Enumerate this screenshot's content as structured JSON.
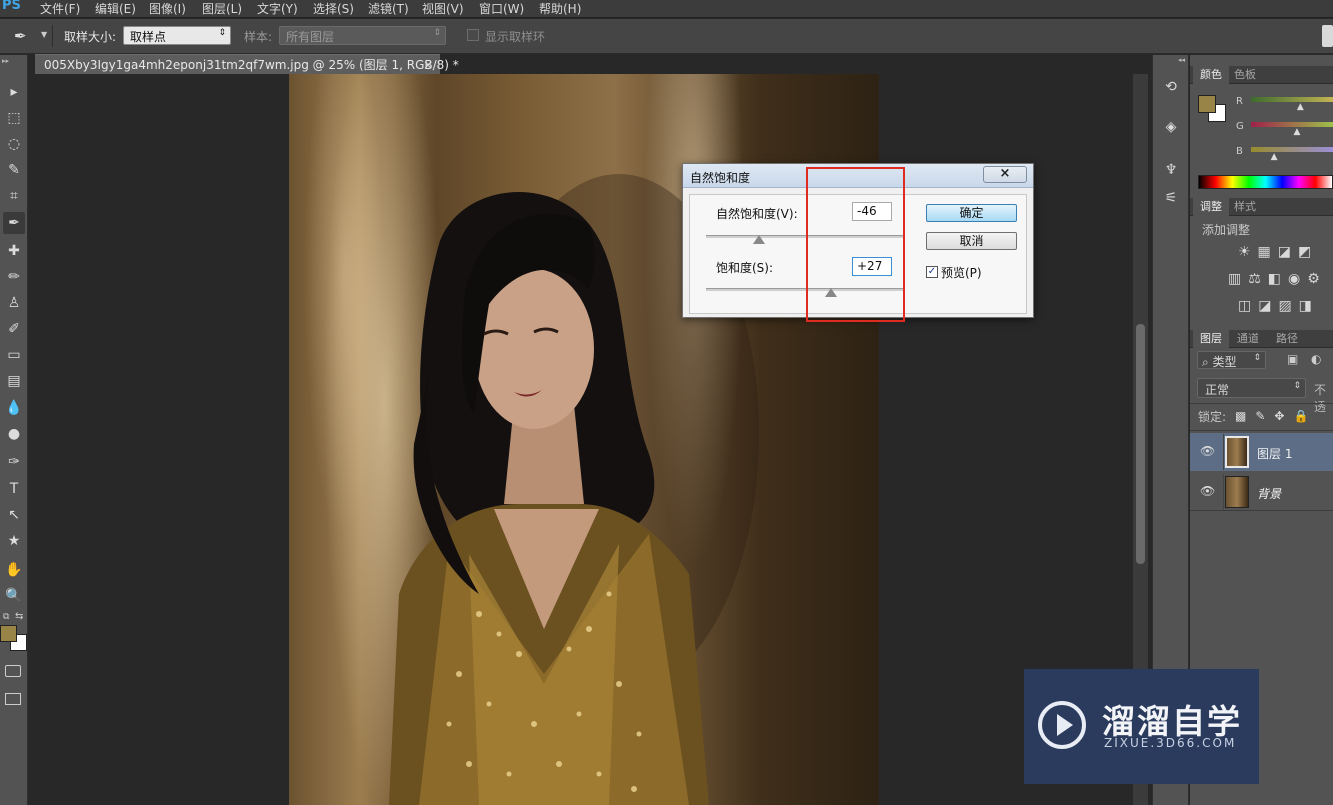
{
  "app": {
    "logo": "PS"
  },
  "menu": [
    "文件(F)",
    "编辑(E)",
    "图像(I)",
    "图层(L)",
    "文字(Y)",
    "选择(S)",
    "滤镜(T)",
    "视图(V)",
    "窗口(W)",
    "帮助(H)"
  ],
  "options_bar": {
    "sample_size_label": "取样大小:",
    "sample_size_value": "取样点",
    "sample_label": "样本:",
    "sample_value": "所有图层",
    "show_ring_label": "显示取样环"
  },
  "document": {
    "tab_title": "005Xby3Igy1ga4mh2eponj31tm2qf7wm.jpg @ 25% (图层 1, RGB/8) *",
    "close_glyph": "×"
  },
  "tools": [
    "move-tool",
    "marquee-tool",
    "lasso-tool",
    "quick-select-tool",
    "crop-tool",
    "eyedropper-tool",
    "healing-tool",
    "brush-tool",
    "stamp-tool",
    "history-brush-tool",
    "eraser-tool",
    "gradient-tool",
    "blur-tool",
    "dodge-tool",
    "pen-tool",
    "type-tool",
    "path-select-tool",
    "shape-tool",
    "hand-tool",
    "zoom-tool"
  ],
  "tool_glyphs": [
    "▸",
    "⬚",
    "◌",
    "✎",
    "⌗",
    "✒",
    "✚",
    "✏",
    "♙",
    "✐",
    "▭",
    "▤",
    "💧",
    "●",
    "✑",
    "T",
    "↖",
    "★",
    "✋",
    "🔍"
  ],
  "colors": {
    "foreground": "#978446",
    "background": "#ffffff"
  },
  "color_panel": {
    "tab_color": "颜色",
    "tab_swatches": "色板",
    "r_label": "R",
    "g_label": "G",
    "b_label": "B",
    "r_value": 0.62,
    "g_value": 0.58,
    "b_value": 0.3
  },
  "adjust_panel": {
    "tab_adjust": "调整",
    "tab_styles": "样式",
    "add_adjustment": "添加调整"
  },
  "layers_panel": {
    "tab_layers": "图层",
    "tab_channels": "通道",
    "tab_paths": "路径",
    "filter_kind": "类型",
    "blend_mode": "正常",
    "opacity_label": "不透",
    "lock_label": "锁定:",
    "layers": [
      {
        "name": "图层 1",
        "selected": true
      },
      {
        "name": "背景",
        "selected": false
      }
    ]
  },
  "dialog": {
    "title": "自然饱和度",
    "close_glyph": "×",
    "vibrance_label": "自然饱和度(V):",
    "vibrance_value": "-46",
    "vibrance_level": -46,
    "saturation_label": "饱和度(S):",
    "saturation_value": "+27",
    "saturation_level": 27,
    "ok_label": "确定",
    "cancel_label": "取消",
    "preview_label": "预览(P)",
    "preview_checked": "✓"
  },
  "watermark": {
    "name": "溜溜自学",
    "url": "ZIXUE.3D66.COM"
  }
}
